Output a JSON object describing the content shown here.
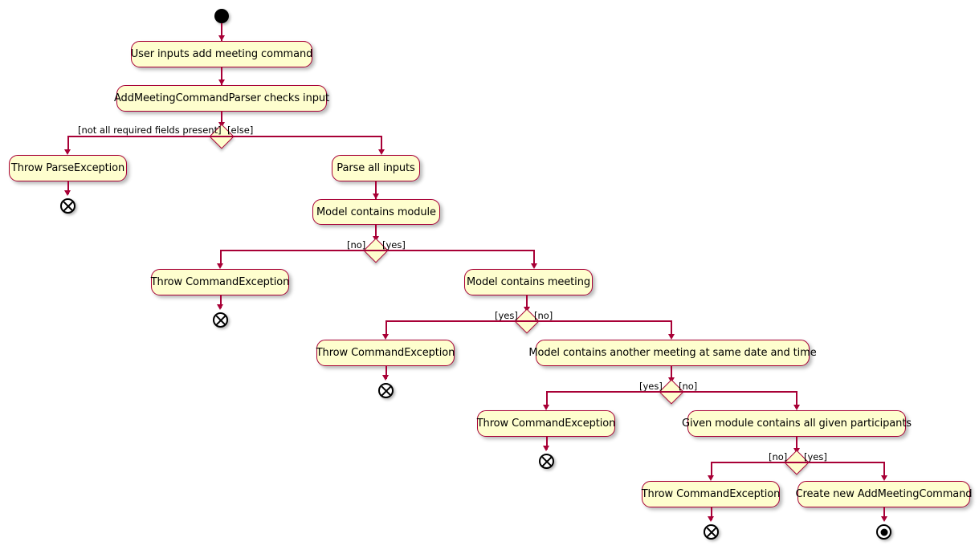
{
  "diagram": {
    "type": "uml-activity-diagram",
    "title": "Add meeting command activity diagram",
    "colors": {
      "node_fill": "#FEFECE",
      "node_border": "#A80036",
      "arrow": "#A80036",
      "text": "#000000",
      "background": "#FFFFFF",
      "start_node": "#000000"
    },
    "nodes": {
      "start": {
        "kind": "start",
        "label": ""
      },
      "a1": {
        "kind": "action",
        "label": "User inputs add meeting command"
      },
      "a2": {
        "kind": "action",
        "label": "AddMeetingCommandParser checks input"
      },
      "d1": {
        "kind": "decision",
        "label": ""
      },
      "a3": {
        "kind": "action",
        "label": "Throw ParseException"
      },
      "e1": {
        "kind": "terminate",
        "label": ""
      },
      "a4": {
        "kind": "action",
        "label": "Parse all inputs"
      },
      "a5": {
        "kind": "action",
        "label": "Model contains module"
      },
      "d2": {
        "kind": "decision",
        "label": ""
      },
      "a6": {
        "kind": "action",
        "label": "Throw CommandException"
      },
      "e2": {
        "kind": "terminate",
        "label": ""
      },
      "a7": {
        "kind": "action",
        "label": "Model contains meeting"
      },
      "d3": {
        "kind": "decision",
        "label": ""
      },
      "a8": {
        "kind": "action",
        "label": "Throw CommandException"
      },
      "e3": {
        "kind": "terminate",
        "label": ""
      },
      "a9": {
        "kind": "action",
        "label": "Model contains another meeting at same date and time"
      },
      "d4": {
        "kind": "decision",
        "label": ""
      },
      "a10": {
        "kind": "action",
        "label": "Throw CommandException"
      },
      "e4": {
        "kind": "terminate",
        "label": ""
      },
      "a11": {
        "kind": "action",
        "label": "Given module contains all given participants"
      },
      "d5": {
        "kind": "decision",
        "label": ""
      },
      "a12": {
        "kind": "action",
        "label": "Throw CommandException"
      },
      "e5": {
        "kind": "terminate",
        "label": ""
      },
      "a13": {
        "kind": "action",
        "label": "Create new AddMeetingCommand"
      },
      "e6": {
        "kind": "final",
        "label": ""
      }
    },
    "guards": {
      "g1_left": "[not all required fields present]",
      "g1_right": "[else]",
      "g2_left": "[no]",
      "g2_right": "[yes]",
      "g3_left": "[yes]",
      "g3_right": "[no]",
      "g4_left": "[yes]",
      "g4_right": "[no]",
      "g5_left": "[no]",
      "g5_right": "[yes]"
    }
  }
}
